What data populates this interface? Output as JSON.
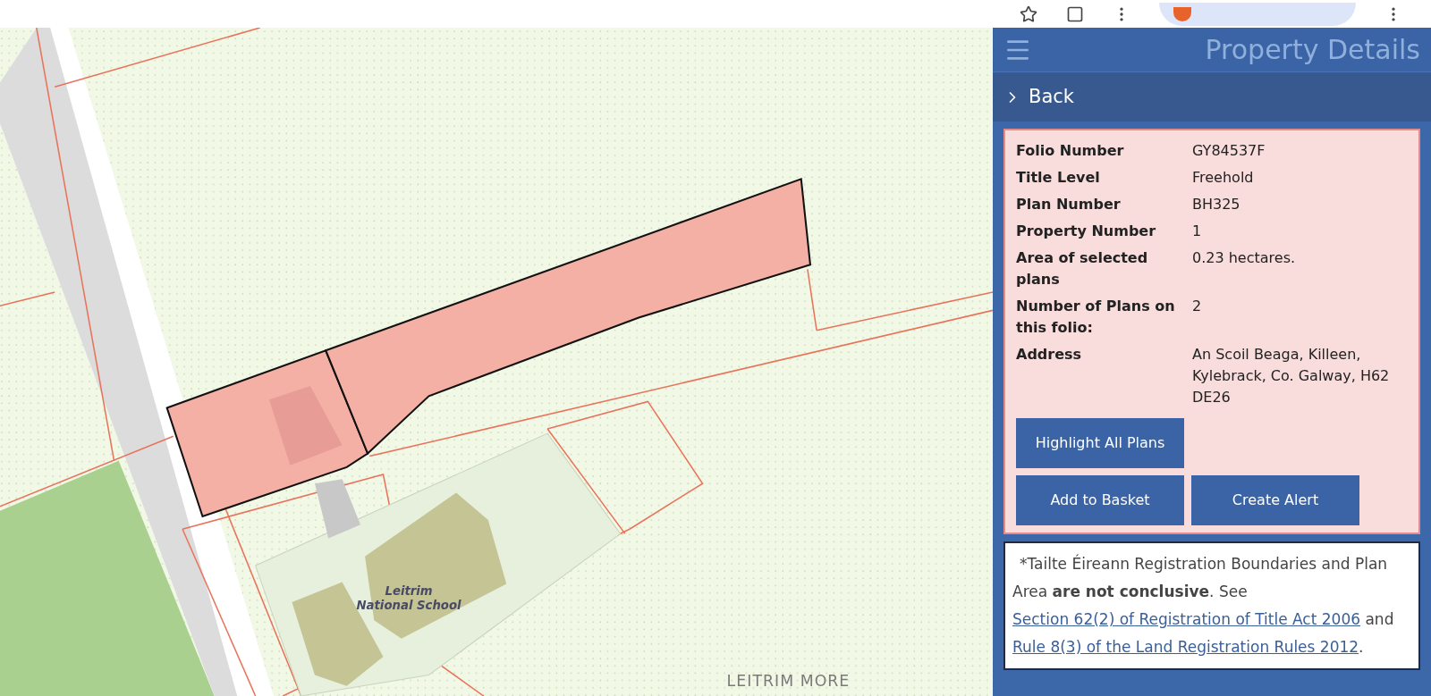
{
  "map": {
    "labels": [
      {
        "kind": "place",
        "text": "Leitrim National School"
      },
      {
        "kind": "townland",
        "text": "LEITRIM MORE"
      }
    ]
  },
  "panel": {
    "title": "Property Details",
    "back": "Back",
    "details": [
      {
        "label": "Folio Number",
        "value": "GY84537F"
      },
      {
        "label": "Title Level",
        "value": "Freehold"
      },
      {
        "label": "Plan Number",
        "value": "BH325"
      },
      {
        "label": "Property Number",
        "value": "1"
      },
      {
        "label": "Area of selected plans",
        "value": "0.23 hectares."
      },
      {
        "label": "Number of Plans on this folio:",
        "value": "2"
      },
      {
        "label": "Address",
        "value": "An Scoil Beaga, Killeen, Kylebrack, Co. Galway, H62 DE26"
      }
    ],
    "buttons": [
      [
        "Highlight All Plans"
      ],
      [
        "Add to Basket",
        "Create Alert"
      ]
    ],
    "note": [
      {
        "kind": "text",
        "text": "*Tailte Éireann Registration Boundaries and Plan Area **are not conclusive**. See "
      },
      {
        "kind": "link",
        "text": "Section 62(2) of Registration of Title Act 2006"
      },
      {
        "kind": "text",
        "text": " and "
      },
      {
        "kind": "link",
        "text": "Rule 8(3) of the Land Registration Rules 2012"
      },
      {
        "kind": "text",
        "text": "."
      }
    ]
  }
}
